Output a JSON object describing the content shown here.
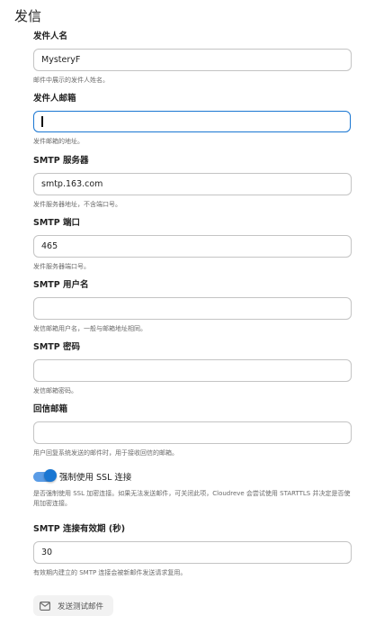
{
  "section": {
    "title": "发信"
  },
  "fields": {
    "sender_name": {
      "label": "发件人名",
      "value": "MysteryF",
      "helper": "邮件中展示的发件人姓名。"
    },
    "sender_email": {
      "label": "发件人邮箱",
      "value": "",
      "helper": "发件邮箱的地址。"
    },
    "smtp_server": {
      "label": "SMTP 服务器",
      "value": "smtp.163.com",
      "helper": "发件服务器地址，不含端口号。"
    },
    "smtp_port": {
      "label": "SMTP 端口",
      "value": "465",
      "helper": "发件服务器端口号。"
    },
    "smtp_username": {
      "label": "SMTP 用户名",
      "value": "",
      "helper": "发信邮箱用户名，一般与邮箱地址相同。"
    },
    "smtp_password": {
      "label": "SMTP 密码",
      "value": "",
      "helper": "发信邮箱密码。"
    },
    "reply_email": {
      "label": "回信邮箱",
      "value": "",
      "helper": "用户回复系统发送的邮件时，用于接收回信的邮箱。"
    },
    "keepalive": {
      "label": "SMTP 连接有效期 (秒)",
      "value": "30",
      "helper": "有效期内建立的 SMTP 连接会被新邮件发送请求复用。"
    }
  },
  "ssl_switch": {
    "label": "强制使用 SSL 连接",
    "checked": true,
    "helper": "是否强制使用 SSL 加密连接。如果无法发送邮件，可关闭此项，Cloudreve 会尝试使用 STARTTLS 并决定是否使用加密连接。",
    "color": "#1976d2"
  },
  "test_button": {
    "label": "发送测试邮件",
    "icon": "mail-icon"
  },
  "colors": {
    "accent": "#1976d2",
    "border": "#c4c4c4",
    "helper_text": "#6b6b6b"
  }
}
